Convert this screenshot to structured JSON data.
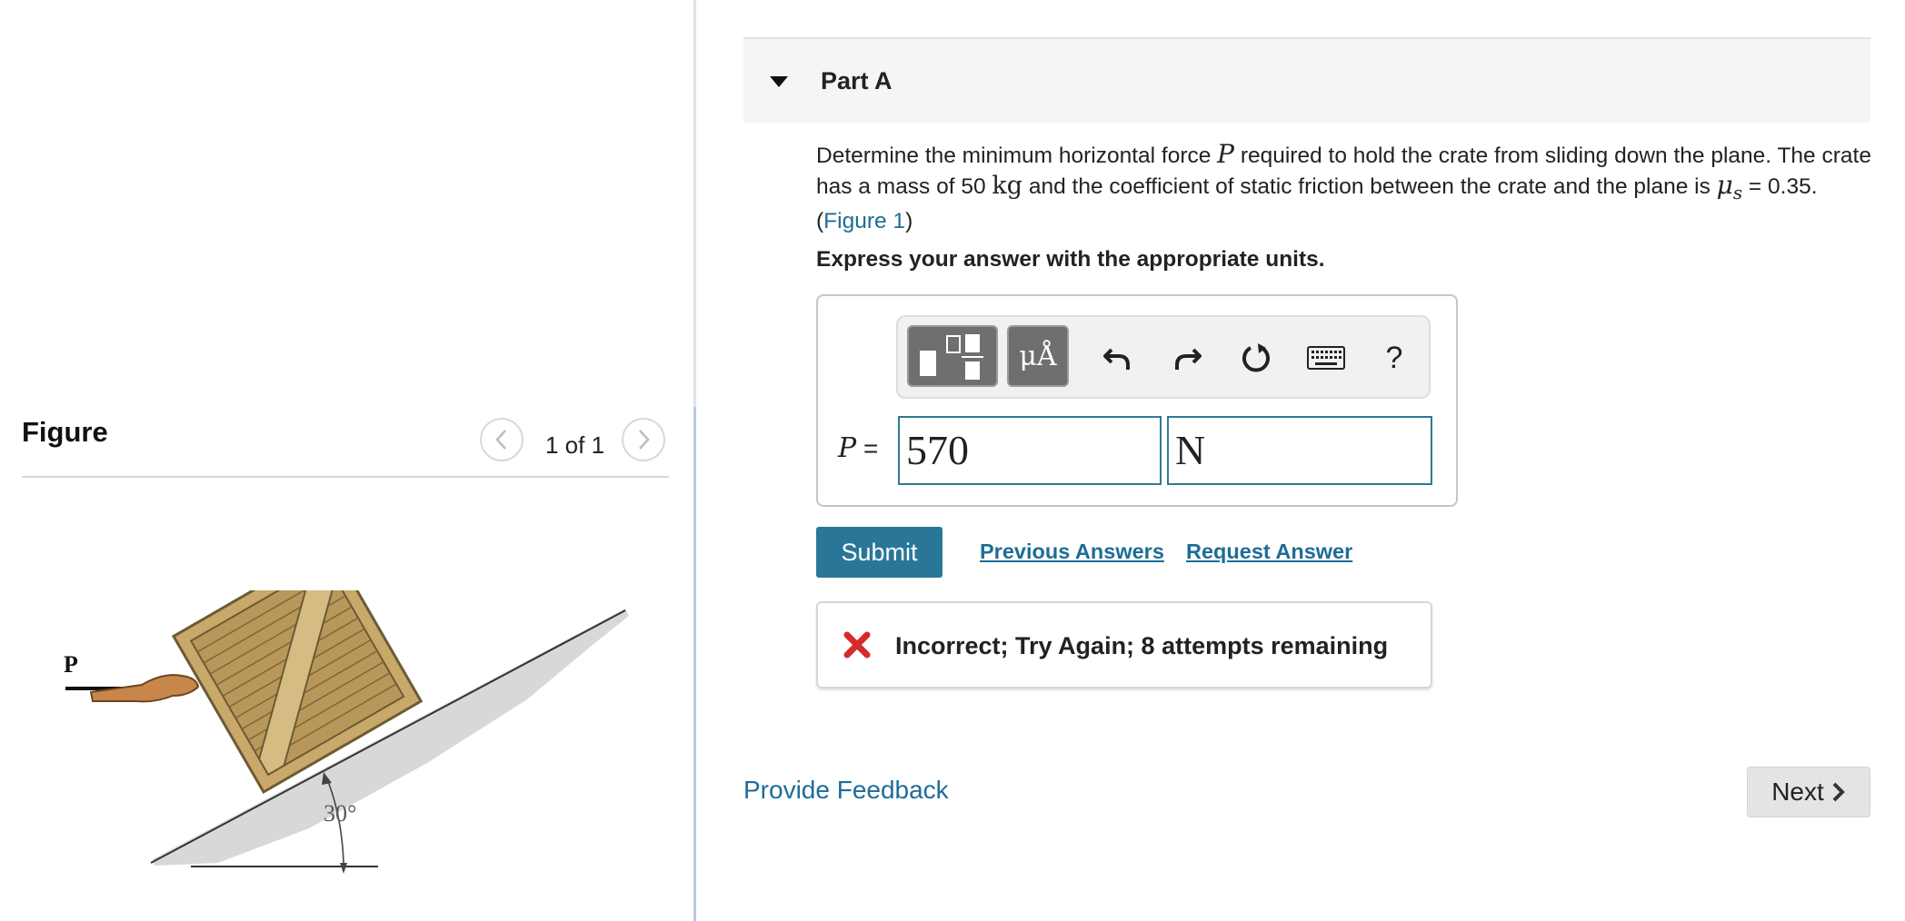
{
  "figure_panel": {
    "title": "Figure",
    "pager_text": "1 of 1",
    "diagram": {
      "force_label": "P",
      "angle_label": "30°"
    }
  },
  "part": {
    "title": "Part A",
    "question_text_1": "Determine the minimum horizontal force ",
    "question_var_P": "P",
    "question_text_2": " required to hold the crate from sliding down the plane. The crate has a mass of 50 ",
    "question_unit_kg": "kg",
    "question_text_3": " and the coefficient of static friction between the crate and the plane is ",
    "question_mu": "μ",
    "question_mu_sub": "s",
    "question_text_4": " = 0.35.(",
    "figure_link": "Figure 1",
    "question_text_5": ")",
    "instruction": "Express your answer with the appropriate units."
  },
  "toolbar": {
    "templates_icon": "fraction-template-icon",
    "units_label": "μÅ",
    "undo_icon": "undo-icon",
    "redo_icon": "redo-icon",
    "reset_icon": "reset-icon",
    "keyboard_icon": "keyboard-icon",
    "help_label": "?"
  },
  "answer": {
    "variable": "P",
    "equals": "=",
    "value": "570",
    "unit": "N"
  },
  "actions": {
    "submit_label": "Submit",
    "previous_answers_label": "Previous Answers",
    "request_answer_label": "Request Answer"
  },
  "feedback": {
    "icon": "error-x-icon",
    "message": "Incorrect; Try Again; 8 attempts remaining",
    "icon_color": "#d52b2b"
  },
  "footer": {
    "provide_feedback_label": "Provide Feedback",
    "next_label": "Next"
  },
  "colors": {
    "accent": "#2a7699",
    "link": "#1d6d96"
  }
}
